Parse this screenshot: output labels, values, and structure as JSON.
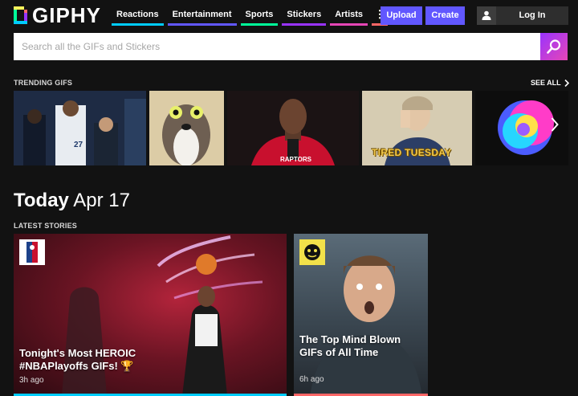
{
  "header": {
    "logo": "GIPHY",
    "nav": [
      {
        "label": "Reactions",
        "color": "#00ccff"
      },
      {
        "label": "Entertainment",
        "color": "#6157ff"
      },
      {
        "label": "Sports",
        "color": "#00ff99"
      },
      {
        "label": "Stickers",
        "color": "#9933ff"
      },
      {
        "label": "Artists",
        "color": "#e646b6"
      }
    ],
    "more_glyph": "⋮",
    "upload_label": "Upload",
    "create_label": "Create",
    "login_label": "Log In"
  },
  "search": {
    "placeholder": "Search all the GIFs and Stickers"
  },
  "trending": {
    "label": "TRENDING GIFS",
    "see_all": "SEE ALL",
    "gifs": [
      {
        "caption": ""
      },
      {
        "caption": ""
      },
      {
        "caption": ""
      },
      {
        "caption": "TIRED TUESDAY"
      },
      {
        "caption": ""
      }
    ]
  },
  "today": {
    "bold": "Today",
    "date": "Apr 17"
  },
  "stories": {
    "label": "LATEST STORIES",
    "items": [
      {
        "title": "Tonight's Most HEROIC #NBAPlayoffs GIFs! 🏆",
        "time": "3h ago",
        "bar_color": "#00ccff"
      },
      {
        "title": "The Top Mind Blown GIFs of All Time",
        "time": "6h ago",
        "bar_color": "#ff6666"
      }
    ]
  }
}
